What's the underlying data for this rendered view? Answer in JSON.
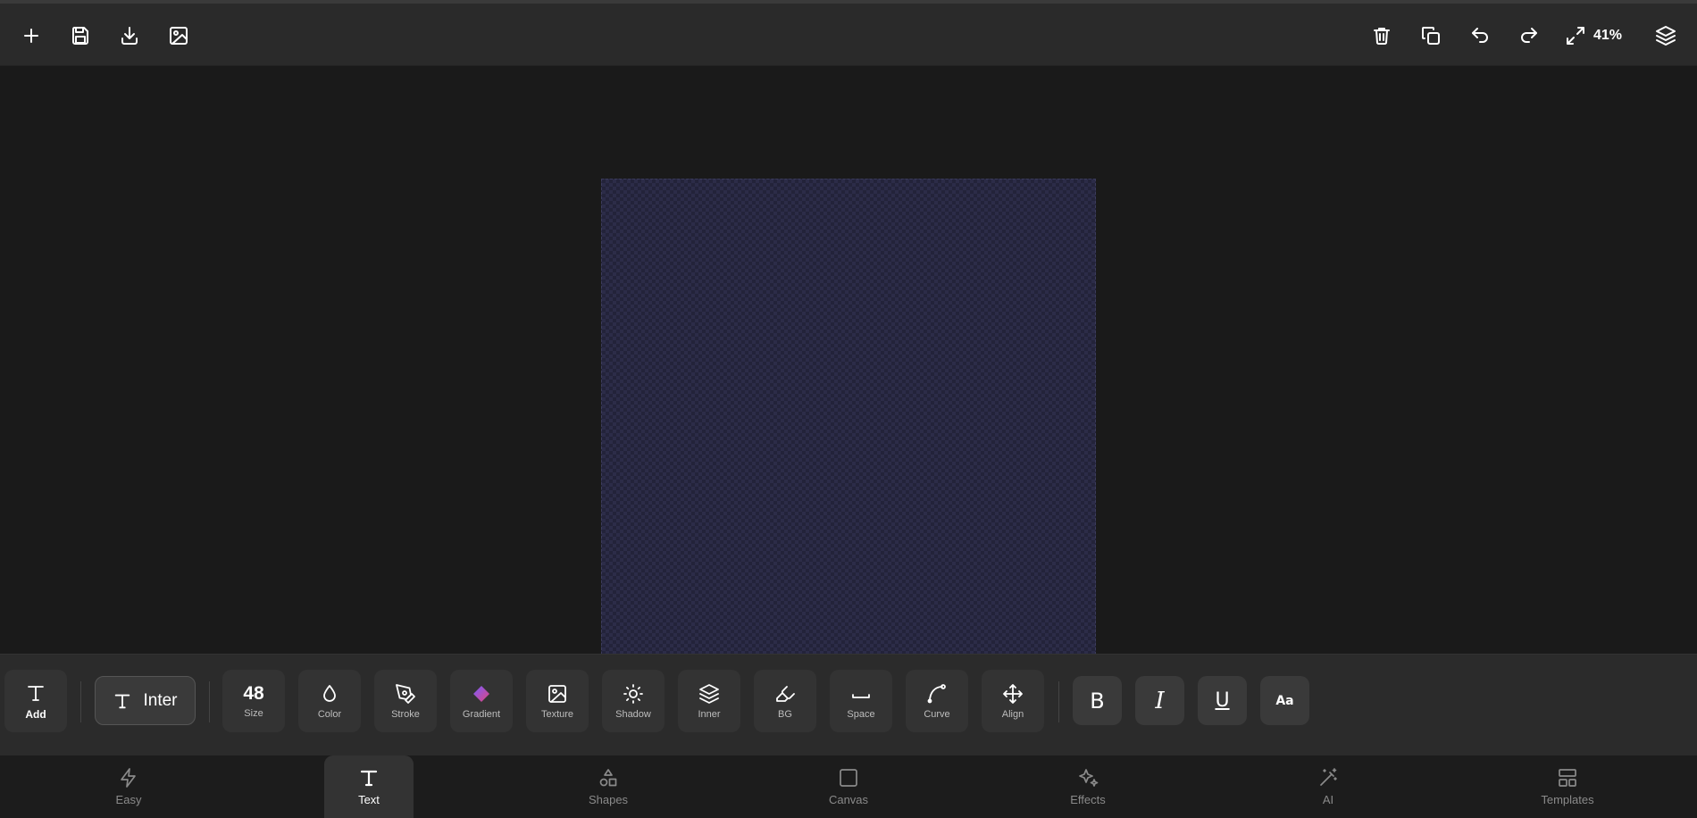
{
  "top_toolbar": {
    "left_icons": [
      "plus-icon",
      "save-icon",
      "download-icon",
      "image-icon"
    ],
    "right_icons": [
      "trash-icon",
      "duplicate-icon",
      "undo-icon",
      "redo-icon",
      "layers-icon"
    ],
    "zoom_level": "41%"
  },
  "text_toolbar": {
    "add_label": "Add",
    "font_name": "Inter",
    "size_value": "48",
    "size_label": "Size",
    "color_label": "Color",
    "stroke_label": "Stroke",
    "gradient_label": "Gradient",
    "texture_label": "Texture",
    "shadow_label": "Shadow",
    "inner_label": "Inner",
    "bg_label": "BG",
    "space_label": "Space",
    "curve_label": "Curve",
    "align_label": "Align",
    "bold_glyph": "B",
    "italic_glyph": "I",
    "underline_glyph": "U",
    "case_glyph": "Aa"
  },
  "bottom_nav": {
    "active": "Text",
    "items": [
      "Easy",
      "Text",
      "Shapes",
      "Canvas",
      "Effects",
      "AI",
      "Templates"
    ]
  },
  "colors": {
    "background": "#1a1a1a",
    "canvas": "#23233a",
    "gradient_icon": [
      "#e0457b",
      "#7a5cff"
    ]
  }
}
